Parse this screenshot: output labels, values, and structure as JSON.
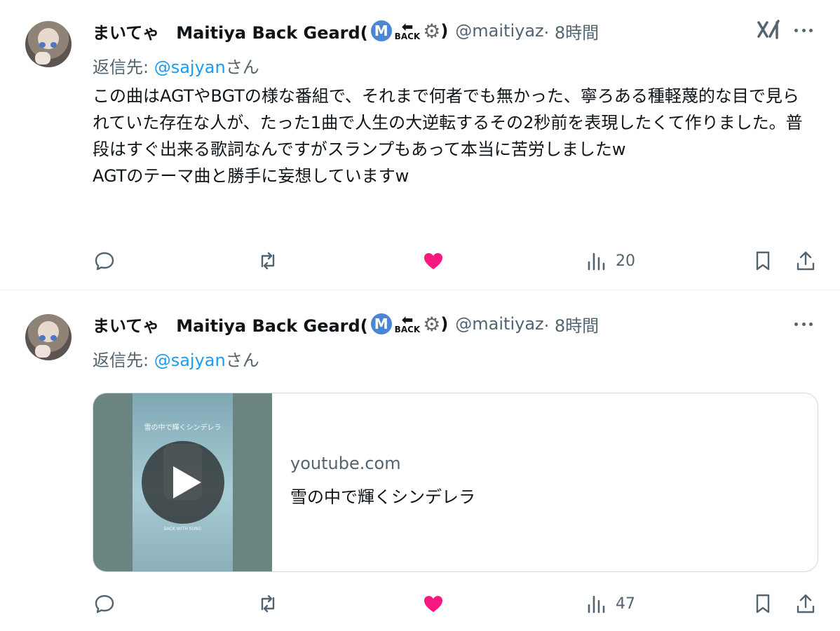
{
  "tweets": [
    {
      "display_name": "まいてゃ　Maitiya Back Geard(",
      "badge_letter": "M",
      "badge_back": "BACK",
      "badge_close": ")",
      "handle": "@maitiyaz",
      "time": " · 8時間",
      "reply_prefix": "返信先: ",
      "reply_handle": "@sajyan",
      "reply_suffix": "さん",
      "text": "この曲はAGTやBGTの様な番組で、それまで何者でも無かった、寧ろある種軽蔑的な目で見られていた存在な人が、たった1曲で人生の大逆転するその2秒前を表現したくて作りました。普段はすぐ出来る歌詞なんですがスランプもあって本当に苦労しましたw\nAGTのテーマ曲と勝手に妄想していますw",
      "views": "20",
      "liked": true
    },
    {
      "display_name": "まいてゃ　Maitiya Back Geard(",
      "badge_letter": "M",
      "badge_back": "BACK",
      "badge_close": ")",
      "handle": "@maitiyaz",
      "time": " · 8時間",
      "reply_prefix": "返信先: ",
      "reply_handle": "@sajyan",
      "reply_suffix": "さん",
      "card": {
        "domain": "youtube.com",
        "title": "雪の中で輝くシンデレラ",
        "poster_title": "雪の中で輝くシンデレラ",
        "poster_footer": "BACK WITH SONG"
      },
      "views": "47",
      "liked": true
    }
  ],
  "icons": [
    "reply-icon",
    "retweet-icon",
    "like-icon",
    "views-icon",
    "bookmark-icon",
    "share-icon",
    "more-icon",
    "grok-icon",
    "gear-icon",
    "play-icon"
  ],
  "colors": {
    "like": "#f91880",
    "link": "#1d9bf0",
    "muted": "#536471",
    "badge": "#4a86d4"
  }
}
